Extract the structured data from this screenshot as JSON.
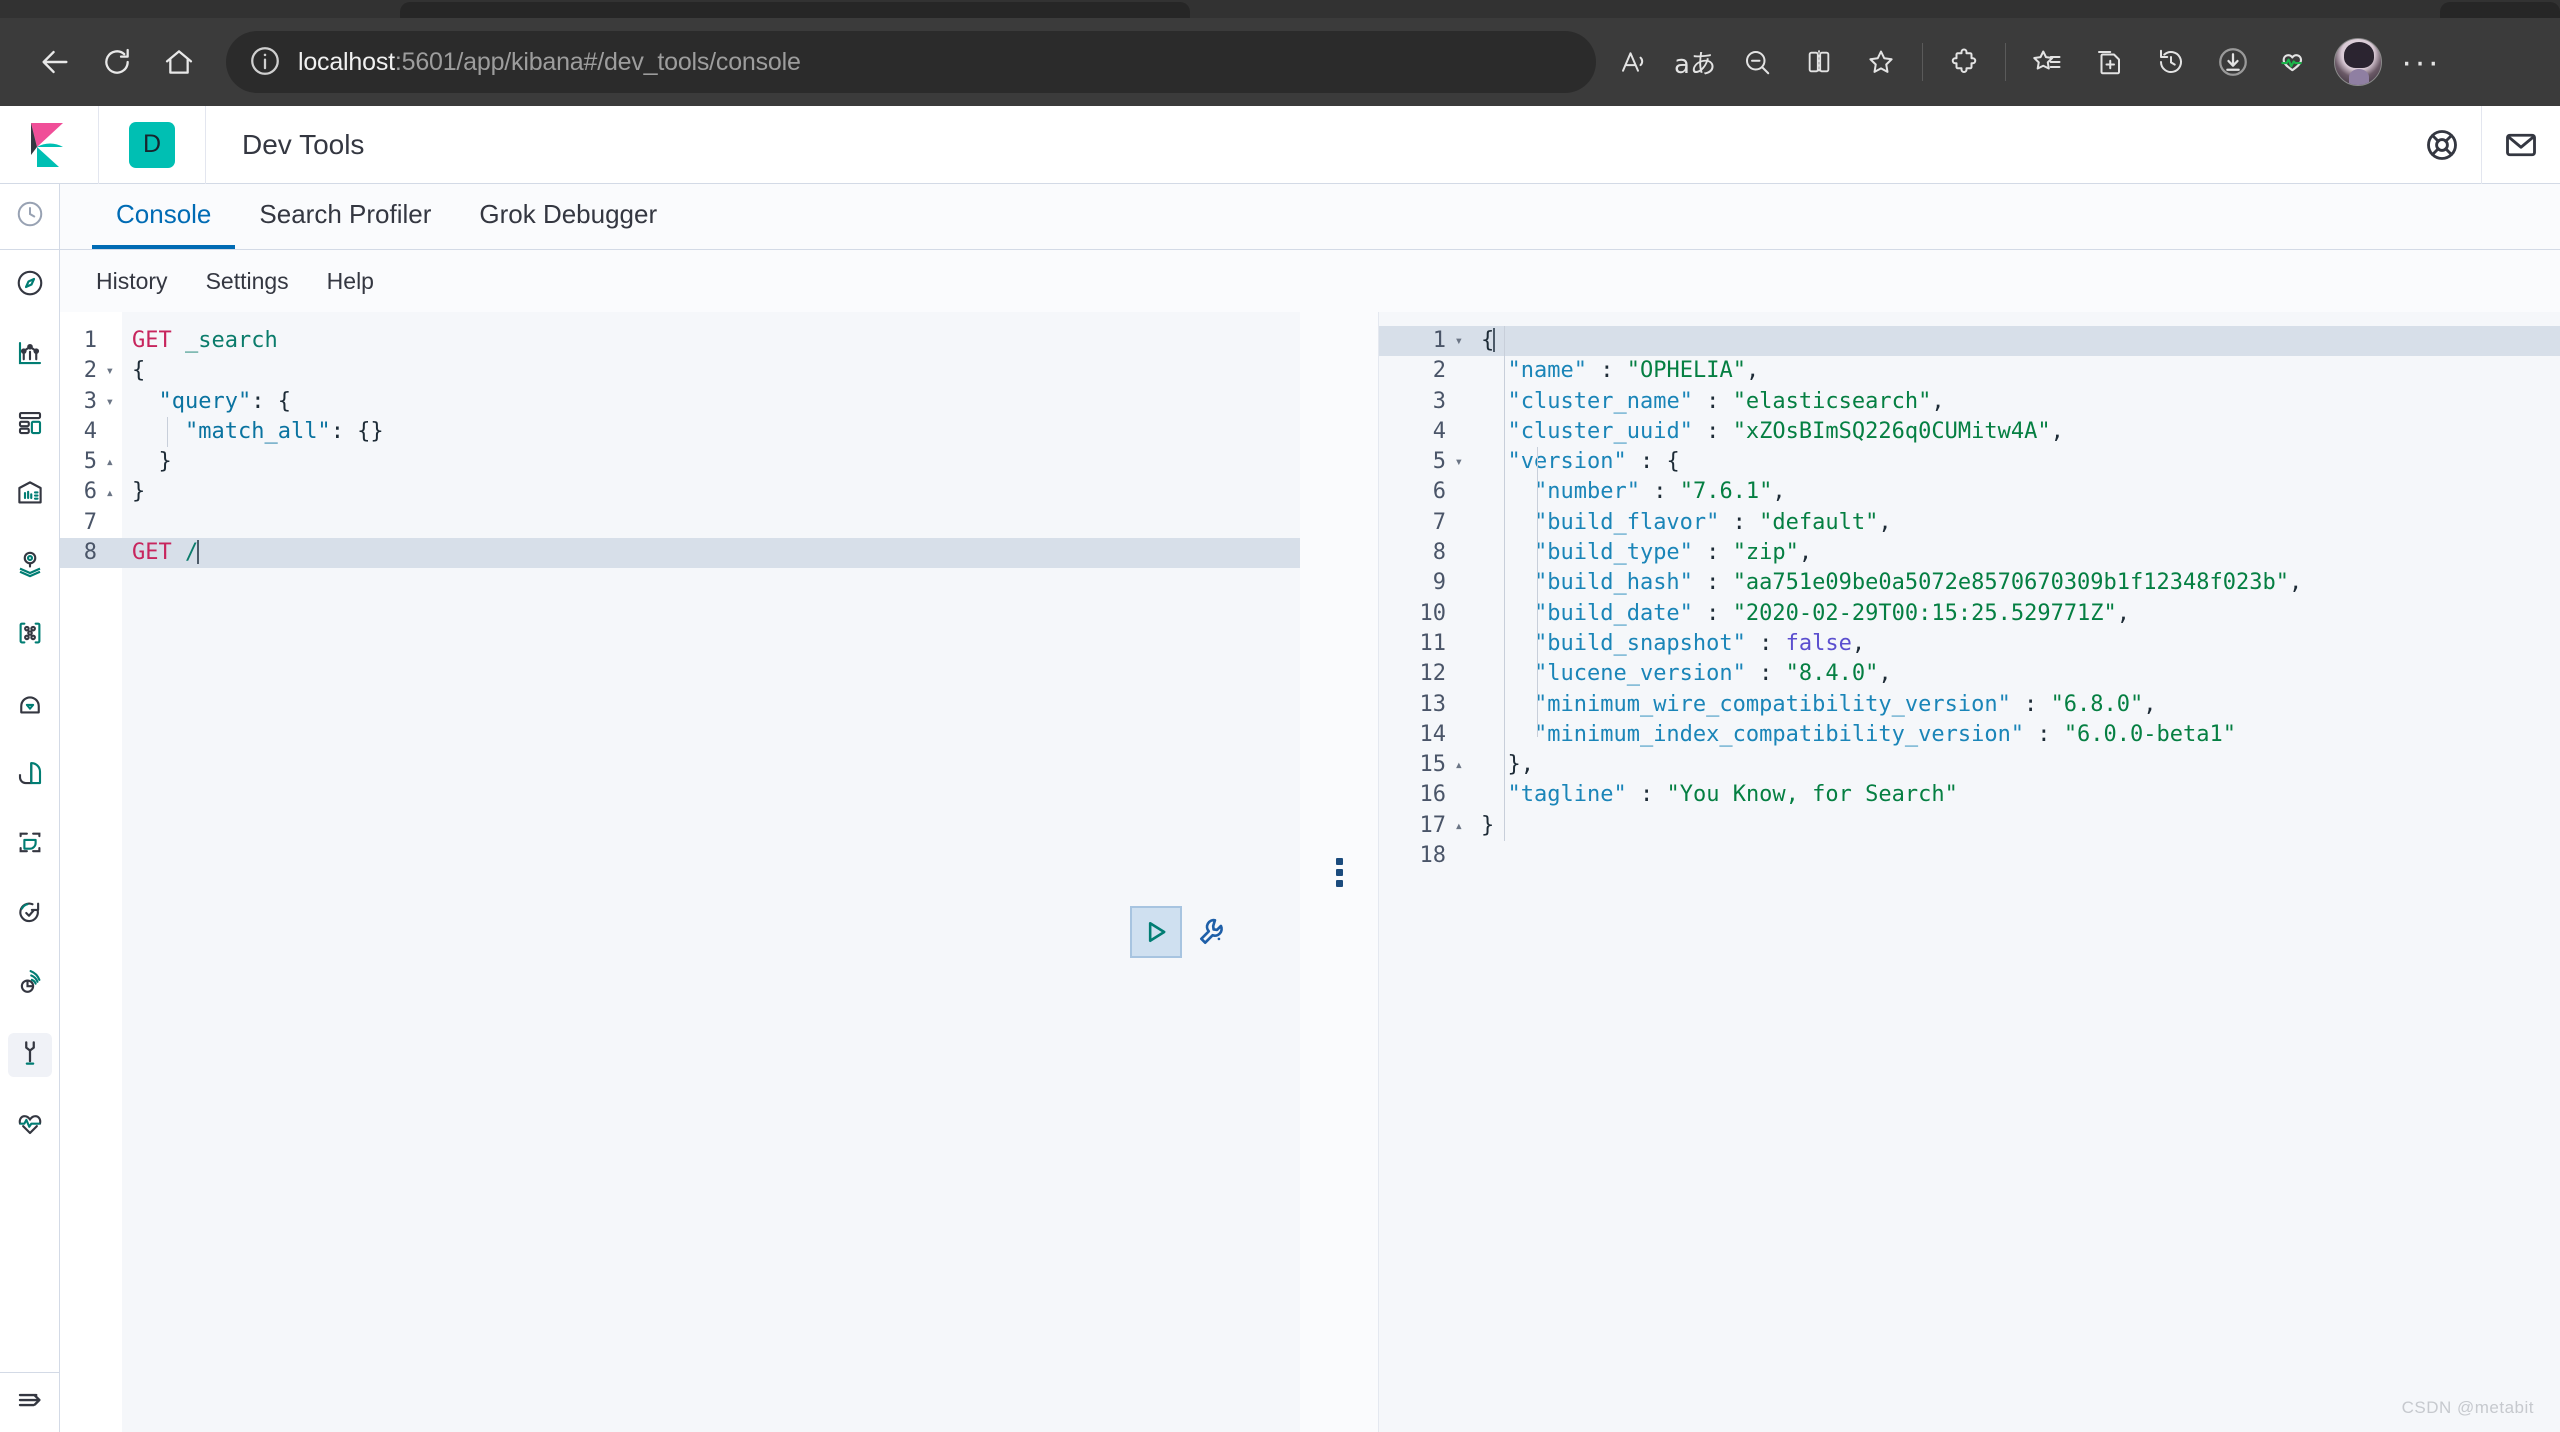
{
  "browser": {
    "url_host": "localhost",
    "url_path": ":5601/app/kibana#/dev_tools/console",
    "nav": {
      "back": "back-arrow",
      "reload": "reload",
      "home": "home"
    },
    "toolbar_icons": [
      "read-aloud-icon",
      "translate-icon",
      "zoom-out-icon",
      "split-screen-icon",
      "favorite-star-icon",
      "extensions-icon",
      "collections-icon",
      "add-to-collections-icon",
      "history-icon",
      "downloads-icon",
      "browser-essentials-icon",
      "profile-avatar",
      "settings-more-icon"
    ],
    "more_label": "···"
  },
  "header": {
    "app_badge": "D",
    "title": "Dev Tools",
    "help_icon": "life-ring-icon",
    "mail_icon": "envelope-icon",
    "logo": "kibana-logo"
  },
  "sidebar": {
    "recent_icon": "clock-icon",
    "items": [
      {
        "name": "discover",
        "icon": "compass-icon"
      },
      {
        "name": "visualize",
        "icon": "bar-chart-icon"
      },
      {
        "name": "dashboard",
        "icon": "dashboard-icon"
      },
      {
        "name": "canvas",
        "icon": "canvas-icon"
      },
      {
        "name": "maps",
        "icon": "map-pin-layers-icon"
      },
      {
        "name": "machine-learning",
        "icon": "ml-nodes-icon"
      },
      {
        "name": "infrastructure",
        "icon": "infrastructure-icon"
      },
      {
        "name": "logs",
        "icon": "logs-icon"
      },
      {
        "name": "apm",
        "icon": "apm-icon"
      },
      {
        "name": "uptime-check",
        "icon": "uptime-check-icon"
      },
      {
        "name": "siem",
        "icon": "siem-icon"
      },
      {
        "name": "dev-tools",
        "icon": "wrench-icon",
        "active": true
      },
      {
        "name": "monitoring",
        "icon": "heart-pulse-icon"
      }
    ],
    "collapse_icon": "collapse-arrow-icon"
  },
  "tabs": [
    {
      "label": "Console",
      "active": true
    },
    {
      "label": "Search Profiler",
      "active": false
    },
    {
      "label": "Grok Debugger",
      "active": false
    }
  ],
  "submenu": [
    {
      "label": "History"
    },
    {
      "label": "Settings"
    },
    {
      "label": "Help"
    }
  ],
  "actions": {
    "play_button": "send-request-play-button",
    "wrench_button": "request-options-wrench-button"
  },
  "request_editor": {
    "lines": [
      {
        "n": "1",
        "fold": "",
        "tokens": [
          {
            "t": "GET",
            "c": "m"
          },
          {
            "t": " ",
            "c": "pn"
          },
          {
            "t": "_search",
            "c": "u"
          }
        ]
      },
      {
        "n": "2",
        "fold": "▾",
        "tokens": [
          {
            "t": "{",
            "c": "pn"
          }
        ]
      },
      {
        "n": "3",
        "fold": "▾",
        "tokens": [
          {
            "t": "  ",
            "c": "pn"
          },
          {
            "t": "\"query\"",
            "c": "k"
          },
          {
            "t": ": {",
            "c": "pn"
          }
        ]
      },
      {
        "n": "4",
        "fold": "",
        "tokens": [
          {
            "t": "    ",
            "c": "pn"
          },
          {
            "t": "\"match_all\"",
            "c": "k"
          },
          {
            "t": ": {}",
            "c": "pn"
          }
        ]
      },
      {
        "n": "5",
        "fold": "▴",
        "tokens": [
          {
            "t": "  }",
            "c": "pn"
          }
        ]
      },
      {
        "n": "6",
        "fold": "▴",
        "tokens": [
          {
            "t": "}",
            "c": "pn"
          }
        ]
      },
      {
        "n": "7",
        "fold": "",
        "tokens": []
      },
      {
        "n": "8",
        "fold": "",
        "highlight": true,
        "caret": true,
        "tokens": [
          {
            "t": "GET",
            "c": "m"
          },
          {
            "t": " ",
            "c": "pn"
          },
          {
            "t": "/",
            "c": "u"
          }
        ]
      }
    ]
  },
  "response_editor": {
    "lines": [
      {
        "n": "1",
        "fold": "▾",
        "highlight": true,
        "caret": true,
        "tokens": [
          {
            "t": "{",
            "c": "pn"
          }
        ]
      },
      {
        "n": "2",
        "fold": "",
        "tokens": [
          {
            "t": "  ",
            "c": "pn"
          },
          {
            "t": "\"name\"",
            "c": "rk"
          },
          {
            "t": " : ",
            "c": "pn"
          },
          {
            "t": "\"OPHELIA\"",
            "c": "sv"
          },
          {
            "t": ",",
            "c": "pn"
          }
        ]
      },
      {
        "n": "3",
        "fold": "",
        "tokens": [
          {
            "t": "  ",
            "c": "pn"
          },
          {
            "t": "\"cluster_name\"",
            "c": "rk"
          },
          {
            "t": " : ",
            "c": "pn"
          },
          {
            "t": "\"elasticsearch\"",
            "c": "sv"
          },
          {
            "t": ",",
            "c": "pn"
          }
        ]
      },
      {
        "n": "4",
        "fold": "",
        "tokens": [
          {
            "t": "  ",
            "c": "pn"
          },
          {
            "t": "\"cluster_uuid\"",
            "c": "rk"
          },
          {
            "t": " : ",
            "c": "pn"
          },
          {
            "t": "\"xZOsBImSQ226q0CUMitw4A\"",
            "c": "sv"
          },
          {
            "t": ",",
            "c": "pn"
          }
        ]
      },
      {
        "n": "5",
        "fold": "▾",
        "tokens": [
          {
            "t": "  ",
            "c": "pn"
          },
          {
            "t": "\"version\"",
            "c": "rk"
          },
          {
            "t": " : {",
            "c": "pn"
          }
        ]
      },
      {
        "n": "6",
        "fold": "",
        "tokens": [
          {
            "t": "    ",
            "c": "pn"
          },
          {
            "t": "\"number\"",
            "c": "rk"
          },
          {
            "t": " : ",
            "c": "pn"
          },
          {
            "t": "\"7.6.1\"",
            "c": "sv"
          },
          {
            "t": ",",
            "c": "pn"
          }
        ]
      },
      {
        "n": "7",
        "fold": "",
        "tokens": [
          {
            "t": "    ",
            "c": "pn"
          },
          {
            "t": "\"build_flavor\"",
            "c": "rk"
          },
          {
            "t": " : ",
            "c": "pn"
          },
          {
            "t": "\"default\"",
            "c": "sv"
          },
          {
            "t": ",",
            "c": "pn"
          }
        ]
      },
      {
        "n": "8",
        "fold": "",
        "tokens": [
          {
            "t": "    ",
            "c": "pn"
          },
          {
            "t": "\"build_type\"",
            "c": "rk"
          },
          {
            "t": " : ",
            "c": "pn"
          },
          {
            "t": "\"zip\"",
            "c": "sv"
          },
          {
            "t": ",",
            "c": "pn"
          }
        ]
      },
      {
        "n": "9",
        "fold": "",
        "tokens": [
          {
            "t": "    ",
            "c": "pn"
          },
          {
            "t": "\"build_hash\"",
            "c": "rk"
          },
          {
            "t": " : ",
            "c": "pn"
          },
          {
            "t": "\"aa751e09be0a5072e8570670309b1f12348f023b\"",
            "c": "sv"
          },
          {
            "t": ",",
            "c": "pn"
          }
        ]
      },
      {
        "n": "10",
        "fold": "",
        "tokens": [
          {
            "t": "    ",
            "c": "pn"
          },
          {
            "t": "\"build_date\"",
            "c": "rk"
          },
          {
            "t": " : ",
            "c": "pn"
          },
          {
            "t": "\"2020-02-29T00:15:25.529771Z\"",
            "c": "sv"
          },
          {
            "t": ",",
            "c": "pn"
          }
        ]
      },
      {
        "n": "11",
        "fold": "",
        "tokens": [
          {
            "t": "    ",
            "c": "pn"
          },
          {
            "t": "\"build_snapshot\"",
            "c": "rk"
          },
          {
            "t": " : ",
            "c": "pn"
          },
          {
            "t": "false",
            "c": "bv"
          },
          {
            "t": ",",
            "c": "pn"
          }
        ]
      },
      {
        "n": "12",
        "fold": "",
        "tokens": [
          {
            "t": "    ",
            "c": "pn"
          },
          {
            "t": "\"lucene_version\"",
            "c": "rk"
          },
          {
            "t": " : ",
            "c": "pn"
          },
          {
            "t": "\"8.4.0\"",
            "c": "sv"
          },
          {
            "t": ",",
            "c": "pn"
          }
        ]
      },
      {
        "n": "13",
        "fold": "",
        "tokens": [
          {
            "t": "    ",
            "c": "pn"
          },
          {
            "t": "\"minimum_wire_compatibility_version\"",
            "c": "rk"
          },
          {
            "t": " : ",
            "c": "pn"
          },
          {
            "t": "\"6.8.0\"",
            "c": "sv"
          },
          {
            "t": ",",
            "c": "pn"
          }
        ]
      },
      {
        "n": "14",
        "fold": "",
        "tokens": [
          {
            "t": "    ",
            "c": "pn"
          },
          {
            "t": "\"minimum_index_compatibility_version\"",
            "c": "rk"
          },
          {
            "t": " : ",
            "c": "pn"
          },
          {
            "t": "\"6.0.0-beta1\"",
            "c": "sv"
          }
        ]
      },
      {
        "n": "15",
        "fold": "▴",
        "tokens": [
          {
            "t": "  },",
            "c": "pn"
          }
        ]
      },
      {
        "n": "16",
        "fold": "",
        "tokens": [
          {
            "t": "  ",
            "c": "pn"
          },
          {
            "t": "\"tagline\"",
            "c": "rk"
          },
          {
            "t": " : ",
            "c": "pn"
          },
          {
            "t": "\"You Know, for Search\"",
            "c": "sv"
          }
        ]
      },
      {
        "n": "17",
        "fold": "▴",
        "tokens": [
          {
            "t": "}",
            "c": "pn"
          }
        ]
      },
      {
        "n": "18",
        "fold": "",
        "tokens": []
      }
    ]
  },
  "watermark": "CSDN @metabit",
  "colors": {
    "accent_blue": "#006bb4",
    "teal": "#00bfb3",
    "dark_teal": "#017d73",
    "method_pink": "#c7255d",
    "string_green": "#057f42",
    "key_blue": "#1a85b8",
    "bool_purple": "#5b4fcf",
    "chrome_dark": "#3b3b3b",
    "editor_bg": "#f5f7fa",
    "active_line": "#d7dfe9"
  }
}
